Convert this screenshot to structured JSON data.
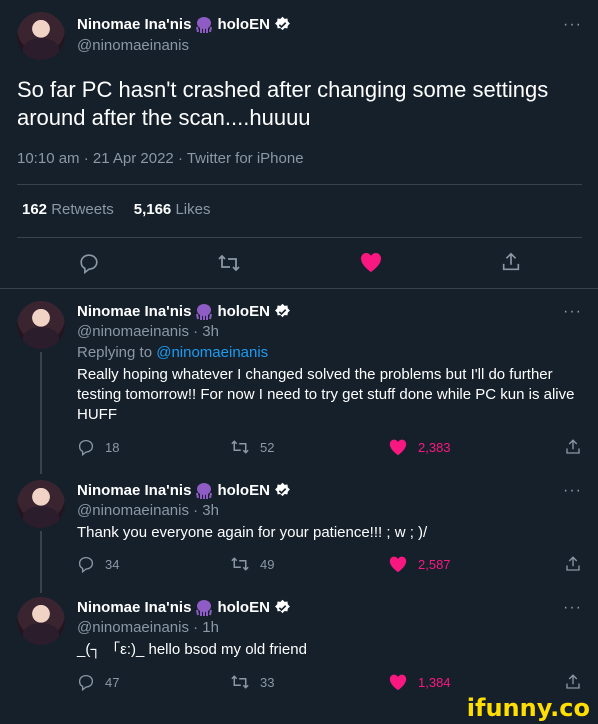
{
  "main": {
    "name": "Ninomae Ina'nis",
    "name_suffix": "holoEN",
    "handle": "@ninomaeinanis",
    "text": "So far PC hasn't crashed after changing some settings around after the scan....huuuu",
    "meta": "10:10 am · 21 Apr 2022 · Twitter for iPhone",
    "retweets_count": "162",
    "retweets_label": "Retweets",
    "likes_count": "5,166",
    "likes_label": "Likes",
    "more": "···"
  },
  "replies": [
    {
      "name": "Ninomae Ina'nis",
      "name_suffix": "holoEN",
      "handle": "@ninomaeinanis · 3h",
      "replying_prefix": "Replying to ",
      "replying_to": "@ninomaeinanis",
      "text": "Really hoping whatever I changed solved the problems but I'll do further testing tomorrow!! For now I need to try get stuff done while PC kun is alive HUFF",
      "replies": "18",
      "retweets": "52",
      "likes": "2,383",
      "more": "···"
    },
    {
      "name": "Ninomae Ina'nis",
      "name_suffix": "holoEN",
      "handle": "@ninomaeinanis · 3h",
      "text": "Thank you everyone again for your patience!!! ; w ; )/",
      "replies": "34",
      "retweets": "49",
      "likes": "2,587",
      "more": "···"
    },
    {
      "name": "Ninomae Ina'nis",
      "name_suffix": "holoEN",
      "handle": "@ninomaeinanis · 1h",
      "text": "_(┐ 「ε:)_ hello bsod my old friend",
      "replies": "47",
      "retweets": "33",
      "likes": "1,384",
      "more": "···"
    }
  ],
  "watermark": "ifunny.co",
  "colors": {
    "background": "#15202b",
    "muted": "#8b98a5",
    "link": "#1d9bf0",
    "like": "#f91880",
    "verified": "#ffffff",
    "octopus": "#8e5cc4"
  }
}
